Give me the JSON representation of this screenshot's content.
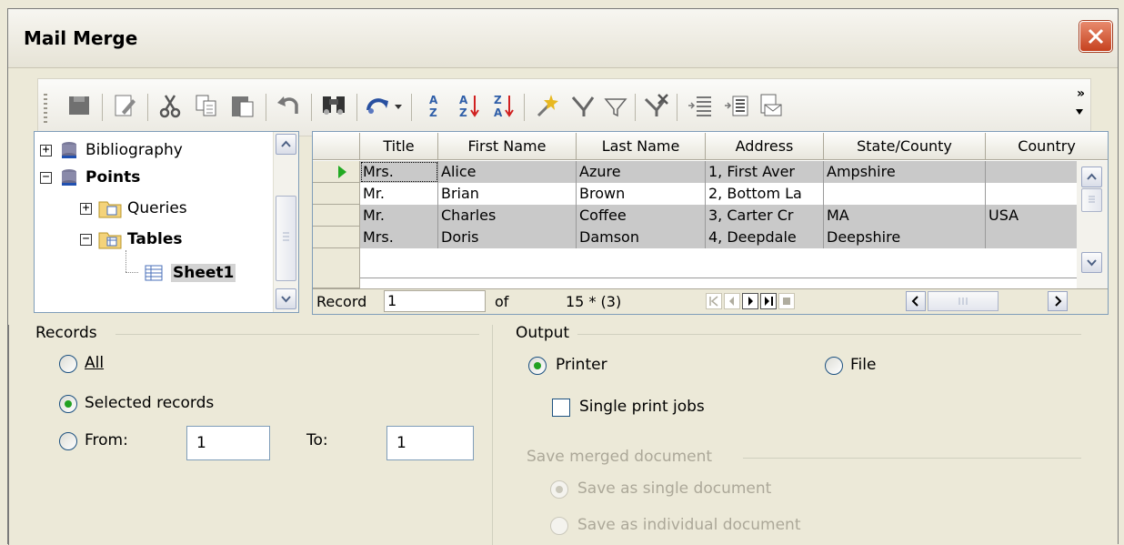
{
  "window": {
    "title": "Mail Merge"
  },
  "toolbar": {
    "icons": [
      "save-record-icon",
      "edit-data-icon",
      "cut-icon",
      "copy-icon",
      "paste-icon",
      "undo-icon",
      "find-record-icon",
      "refresh-icon",
      "sort-icon",
      "sort-ascending-icon",
      "sort-descending-icon",
      "autofilter-icon",
      "apply-filter-icon",
      "standard-filter-icon",
      "remove-filter-icon",
      "data-to-text-icon",
      "data-to-fields-icon",
      "mail-merge-icon"
    ],
    "more": "»"
  },
  "tree": {
    "items": [
      {
        "label": "Bibliography",
        "bold": false,
        "sign": "+"
      },
      {
        "label": "Points",
        "bold": true,
        "sign": "−"
      },
      {
        "label": "Queries",
        "bold": false,
        "sign": "+"
      },
      {
        "label": "Tables",
        "bold": true,
        "sign": "−"
      },
      {
        "label": "Sheet1",
        "bold": true,
        "selected": true
      }
    ]
  },
  "grid": {
    "columns": [
      "Title",
      "First Name",
      "Last Name",
      "Address",
      "State/County",
      "Country"
    ],
    "rows": [
      [
        "Mrs.",
        "Alice",
        "Azure",
        "1, First Aver",
        "Ampshire",
        ""
      ],
      [
        "Mr.",
        "Brian",
        "Brown",
        "2, Bottom La",
        "",
        ""
      ],
      [
        "Mr.",
        "Charles",
        "Coffee",
        "3, Carter Cr",
        "MA",
        "USA"
      ],
      [
        "Mrs.",
        "Doris",
        "Damson",
        "4, Deepdale",
        "Deepshire",
        ""
      ]
    ],
    "selected_rows": [
      0,
      2,
      3
    ],
    "navigator": {
      "record_label": "Record",
      "record_value": "1",
      "of_label": "of",
      "count": "15 * (3)"
    }
  },
  "records": {
    "label": "Records",
    "all": "All",
    "selected": "Selected records",
    "from": "From:",
    "to": "To:",
    "from_value": "1",
    "to_value": "1",
    "choice": "selected"
  },
  "output": {
    "label": "Output",
    "printer": "Printer",
    "file": "File",
    "single_print_jobs": "Single print jobs",
    "save_merged": "Save merged document",
    "save_single": "Save as single document",
    "save_individual": "Save as individual document",
    "choice": "printer"
  }
}
